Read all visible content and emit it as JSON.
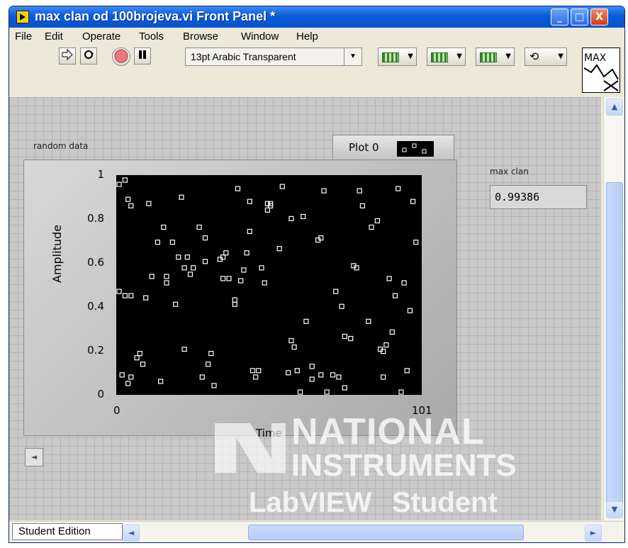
{
  "window": {
    "title": "max clan od 100brojeva.vi Front Panel *",
    "buttons": {
      "minimize": "_",
      "maximize": "□",
      "close": "X"
    }
  },
  "menu": [
    "File",
    "Edit",
    "Operate",
    "Tools",
    "Browse",
    "Window",
    "Help"
  ],
  "toolbar": {
    "font_select": "13pt Arabic Transparent",
    "buttons": [
      "run-arrow",
      "run-continuously",
      "abort-execution",
      "pause"
    ]
  },
  "vi_icon_text": "MAX",
  "graph": {
    "label": "random data",
    "legend": {
      "plot_name": "Plot 0"
    },
    "yticks": [
      "1",
      "0.8",
      "0.6",
      "0.4",
      "0.2",
      "0"
    ],
    "xticks": [
      "0",
      "101"
    ],
    "xlabel": "Time",
    "ylabel": "Amplitude"
  },
  "indicator": {
    "label": "max clan",
    "value": "0.99386"
  },
  "statusbar": {
    "student_label": "Student Edition"
  },
  "watermark": {
    "line1": "NATIONAL",
    "line2": "INSTRUMENTS",
    "line3": "LabVIEW",
    "line4": "Student Edition"
  },
  "chart_data": {
    "type": "scatter",
    "title": "random data",
    "xlabel": "Time",
    "ylabel": "Amplitude",
    "xlim": [
      0,
      101
    ],
    "ylim": [
      0,
      1
    ],
    "series": [
      {
        "name": "Plot 0",
        "points": [
          [
            0,
            0.97
          ],
          [
            2,
            0.99
          ],
          [
            3,
            0.9
          ],
          [
            4,
            0.87
          ],
          [
            0,
            0.47
          ],
          [
            2,
            0.45
          ],
          [
            4,
            0.45
          ],
          [
            1,
            0.08
          ],
          [
            3,
            0.04
          ],
          [
            4,
            0.07
          ],
          [
            6,
            0.16
          ],
          [
            7,
            0.18
          ],
          [
            8,
            0.13
          ],
          [
            9,
            0.44
          ],
          [
            10,
            0.88
          ],
          [
            11,
            0.54
          ],
          [
            13,
            0.7
          ],
          [
            14,
            0.05
          ],
          [
            15,
            0.77
          ],
          [
            16,
            0.54
          ],
          [
            16,
            0.51
          ],
          [
            18,
            0.7
          ],
          [
            19,
            0.41
          ],
          [
            20,
            0.63
          ],
          [
            21,
            0.91
          ],
          [
            22,
            0.2
          ],
          [
            22,
            0.58
          ],
          [
            23,
            0.63
          ],
          [
            24,
            0.55
          ],
          [
            25,
            0.58
          ],
          [
            27,
            0.77
          ],
          [
            28,
            0.07
          ],
          [
            29,
            0.61
          ],
          [
            29,
            0.72
          ],
          [
            30,
            0.13
          ],
          [
            31,
            0.18
          ],
          [
            32,
            0.03
          ],
          [
            34,
            0.62
          ],
          [
            35,
            0.53
          ],
          [
            35,
            0.63
          ],
          [
            36,
            0.65
          ],
          [
            37,
            0.53
          ],
          [
            39,
            0.43
          ],
          [
            39,
            0.41
          ],
          [
            40,
            0.95
          ],
          [
            41,
            0.52
          ],
          [
            42,
            0.57
          ],
          [
            43,
            0.65
          ],
          [
            44,
            0.89
          ],
          [
            44,
            0.75
          ],
          [
            45,
            0.1
          ],
          [
            46,
            0.07
          ],
          [
            47,
            0.1
          ],
          [
            48,
            0.58
          ],
          [
            49,
            0.51
          ],
          [
            50,
            0.85
          ],
          [
            50,
            0.88
          ],
          [
            51,
            0.87
          ],
          [
            51,
            0.88
          ],
          [
            54,
            0.67
          ],
          [
            55,
            0.96
          ],
          [
            57,
            0.09
          ],
          [
            58,
            0.81
          ],
          [
            58,
            0.24
          ],
          [
            59,
            0.21
          ],
          [
            60,
            0.1
          ],
          [
            61,
            0.0
          ],
          [
            62,
            0.82
          ],
          [
            63,
            0.33
          ],
          [
            65,
            0.06
          ],
          [
            65,
            0.12
          ],
          [
            67,
            0.71
          ],
          [
            68,
            0.72
          ],
          [
            68,
            0.08
          ],
          [
            69,
            0.94
          ],
          [
            70,
            0.0
          ],
          [
            72,
            0.08
          ],
          [
            73,
            0.47
          ],
          [
            74,
            0.07
          ],
          [
            75,
            0.4
          ],
          [
            76,
            0.02
          ],
          [
            76,
            0.26
          ],
          [
            78,
            0.25
          ],
          [
            79,
            0.59
          ],
          [
            80,
            0.58
          ],
          [
            81,
            0.94
          ],
          [
            82,
            0.87
          ],
          [
            84,
            0.33
          ],
          [
            85,
            0.77
          ],
          [
            87,
            0.8
          ],
          [
            88,
            0.2
          ],
          [
            89,
            0.07
          ],
          [
            89,
            0.19
          ],
          [
            90,
            0.22
          ],
          [
            91,
            0.53
          ],
          [
            92,
            0.28
          ],
          [
            93,
            0.45
          ],
          [
            94,
            0.95
          ],
          [
            95,
            0.0
          ],
          [
            96,
            0.51
          ],
          [
            97,
            0.1
          ],
          [
            98,
            0.38
          ],
          [
            99,
            0.89
          ],
          [
            100,
            0.7
          ]
        ]
      }
    ]
  }
}
